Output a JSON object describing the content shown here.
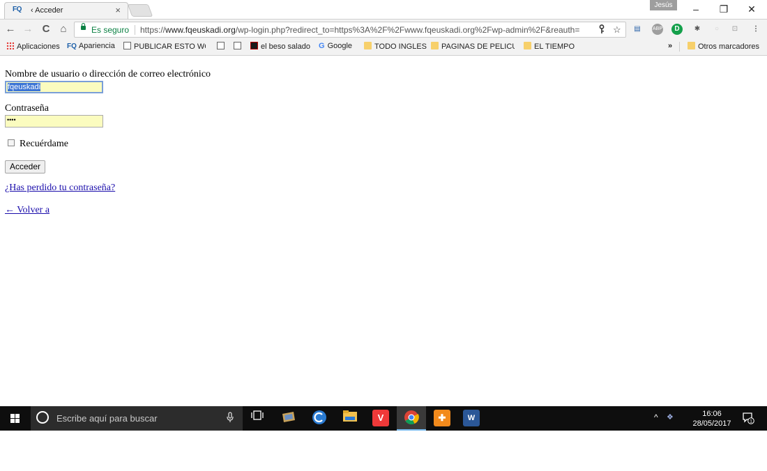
{
  "browser": {
    "tab": {
      "favicon_text": "FQ",
      "title": "‹ Acceder",
      "close": "×"
    },
    "profile_name": "Jesús",
    "window_controls": {
      "minimize": "–",
      "restore": "❐",
      "close": "✕"
    },
    "nav": {
      "back": "←",
      "forward": "→",
      "reload": "C",
      "home": "⌂"
    },
    "address": {
      "secure_label": "Es seguro",
      "scheme": "https://",
      "host": "www.fqeuskadi.org",
      "path": "/wp-login.php?redirect_to=https%3A%2F%2Fwww.fqeuskadi.org%2Fwp-admin%2F&reauth="
    },
    "bookmarks": [
      {
        "label": "Aplicaciones",
        "icon": "apps-grid-icon"
      },
      {
        "label": "Apariencia",
        "icon": "fq-favicon"
      },
      {
        "label": "PUBLICAR ESTO WOR",
        "icon": "page-icon"
      },
      {
        "label": "",
        "icon": "page-icon"
      },
      {
        "label": "",
        "icon": "page-icon"
      },
      {
        "label": "el beso salado",
        "icon": "site-favicon"
      },
      {
        "label": "Google",
        "icon": "google-icon"
      },
      {
        "label": "TODO INGLES",
        "icon": "folder-icon"
      },
      {
        "label": "PAGINAS DE PELICUL",
        "icon": "folder-icon"
      },
      {
        "label": "EL TIEMPO",
        "icon": "folder-icon"
      }
    ],
    "bookmarks_overflow": "»",
    "other_bookmarks": "Otros marcadores"
  },
  "login": {
    "username_label": "Nombre de usuario o dirección de correo electrónico",
    "username_value": "fqeuskadi",
    "password_label": "Contraseña",
    "password_value": "••••",
    "remember_label": "Recuérdame",
    "submit_label": "Acceder",
    "lost_password": "¿Has perdido tu contraseña?",
    "back_link": "← Volver a"
  },
  "taskbar": {
    "search_placeholder": "Escribe aquí para buscar",
    "apps": [
      "task-view",
      "photos",
      "ccleaner",
      "file-explorer",
      "vivaldi",
      "chrome",
      "avast",
      "word"
    ],
    "tray_chevron": "^",
    "time": "16:06",
    "date": "28/05/2017",
    "notification_count": "1"
  },
  "colors": {
    "accent_link": "#1a0dab",
    "secure_green": "#0b8043",
    "autofill_yellow": "#fbfcbf"
  }
}
